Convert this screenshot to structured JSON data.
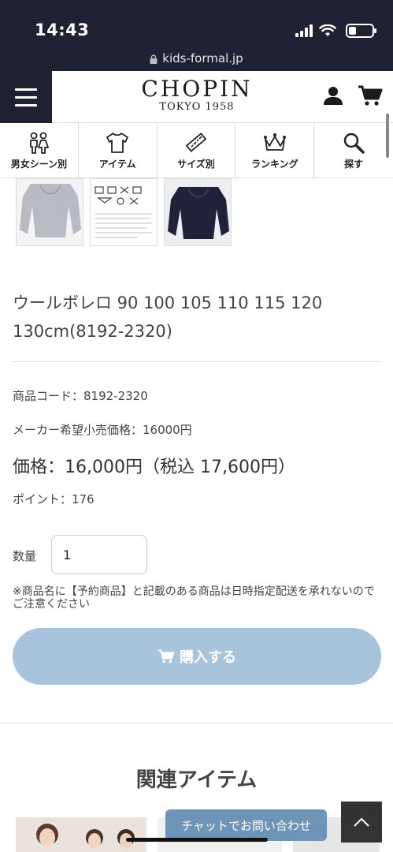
{
  "status_bar": {
    "time": "14:43"
  },
  "browser": {
    "url": "kids-formal.jp"
  },
  "header": {
    "brand": "CHOPIN",
    "sub": "TOKYO 1958"
  },
  "category_nav": [
    {
      "label": "男女シーン別",
      "icon": "boy-girl-icon"
    },
    {
      "label": "アイテム",
      "icon": "tshirt-icon"
    },
    {
      "label": "サイズ別",
      "icon": "ruler-icon"
    },
    {
      "label": "ランキング",
      "icon": "crown-icon"
    },
    {
      "label": "探す",
      "icon": "search-icon"
    }
  ],
  "product": {
    "title": "ウールボレロ 90 100 105 110 115 120 130cm(8192-2320)",
    "code_label": "商品コード：8192-2320",
    "msrp_label": "メーカー希望小売価格：16000円",
    "price_label": "価格：16,000円（税込 17,600円）",
    "points_label": "ポイント：176",
    "quantity_label": "数量",
    "quantity_value": "1",
    "notice": "※商品名に【予約商品】と記載のある商品は日時指定配送を承れないのでご注意ください",
    "buy_label": "購入する"
  },
  "related": {
    "title": "関連アイテム"
  },
  "chat": {
    "label": "チャットでお問い合わせ"
  },
  "colors": {
    "navy": "#1e2233",
    "buy_button": "#a8c4dc",
    "chat_button": "#6e95b8"
  }
}
